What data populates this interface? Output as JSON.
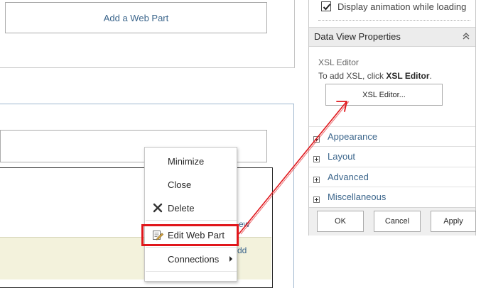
{
  "page": {
    "add_web_part_label": "Add a Web Part",
    "edge_link_1": "ew",
    "edge_link_2": "dd"
  },
  "context_menu": {
    "items": [
      {
        "label": "Minimize"
      },
      {
        "label": "Close"
      },
      {
        "label": "Delete",
        "icon": "delete-x-icon"
      },
      {
        "label": "Edit Web Part",
        "icon": "edit-web-part-icon",
        "highlighted": true
      },
      {
        "label": "Connections",
        "has_submenu": true
      }
    ]
  },
  "tool_pane": {
    "checkbox_label": "Display animation while loading",
    "checkbox_checked": true,
    "section_title": "Data View Properties",
    "xsl_title": "XSL Editor",
    "xsl_desc_prefix": "To add XSL, click ",
    "xsl_desc_bold": "XSL Editor",
    "xsl_desc_suffix": ".",
    "xsl_button": "XSL Editor...",
    "sections": [
      "Appearance",
      "Layout",
      "Advanced",
      "Miscellaneous"
    ],
    "buttons": {
      "ok": "OK",
      "cancel": "Cancel",
      "apply": "Apply"
    }
  },
  "colors": {
    "link_blue": "#3c668c",
    "annotation_red": "#e0161b",
    "band_yellow": "#f3f2dc"
  }
}
